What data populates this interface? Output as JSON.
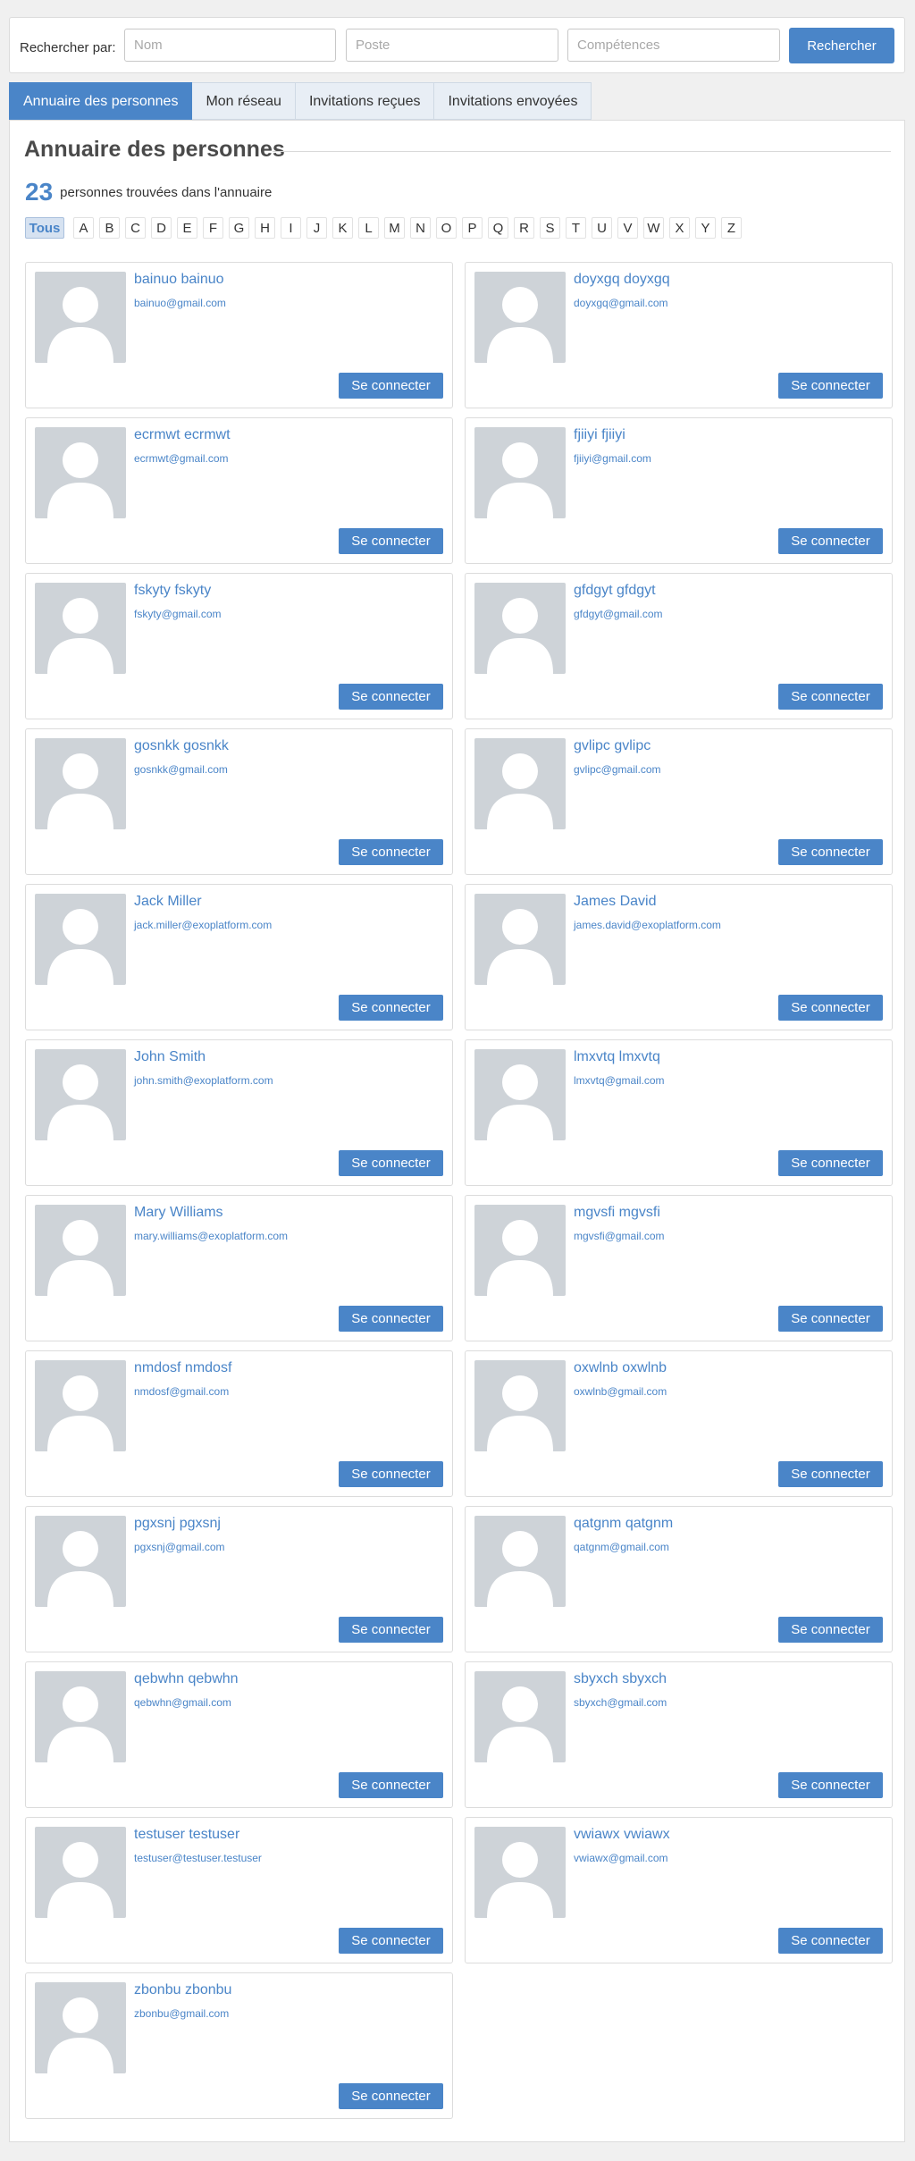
{
  "search": {
    "label": "Rechercher par:",
    "name_placeholder": "Nom",
    "position_placeholder": "Poste",
    "skills_placeholder": "Compétences",
    "button": "Rechercher"
  },
  "tabs": [
    {
      "label": "Annuaire des personnes",
      "active": true
    },
    {
      "label": "Mon réseau",
      "active": false
    },
    {
      "label": "Invitations reçues",
      "active": false
    },
    {
      "label": "Invitations envoyées",
      "active": false
    }
  ],
  "directory": {
    "title": "Annuaire des personnes",
    "count": "23",
    "count_text": "personnes trouvées dans l'annuaire",
    "all_label": "Tous",
    "letters": [
      "A",
      "B",
      "C",
      "D",
      "E",
      "F",
      "G",
      "H",
      "I",
      "J",
      "K",
      "L",
      "M",
      "N",
      "O",
      "P",
      "Q",
      "R",
      "S",
      "T",
      "U",
      "V",
      "W",
      "X",
      "Y",
      "Z"
    ],
    "connect_label": "Se connecter"
  },
  "people": [
    {
      "name": "bainuo bainuo",
      "email": "bainuo@gmail.com"
    },
    {
      "name": "doyxgq doyxgq",
      "email": "doyxgq@gmail.com"
    },
    {
      "name": "ecrmwt ecrmwt",
      "email": "ecrmwt@gmail.com"
    },
    {
      "name": "fjiiyi fjiiyi",
      "email": "fjiiyi@gmail.com"
    },
    {
      "name": "fskyty fskyty",
      "email": "fskyty@gmail.com"
    },
    {
      "name": "gfdgyt gfdgyt",
      "email": "gfdgyt@gmail.com"
    },
    {
      "name": "gosnkk gosnkk",
      "email": "gosnkk@gmail.com"
    },
    {
      "name": "gvlipc gvlipc",
      "email": "gvlipc@gmail.com"
    },
    {
      "name": "Jack Miller",
      "email": "jack.miller@exoplatform.com"
    },
    {
      "name": "James David",
      "email": "james.david@exoplatform.com"
    },
    {
      "name": "John Smith",
      "email": "john.smith@exoplatform.com"
    },
    {
      "name": "lmxvtq lmxvtq",
      "email": "lmxvtq@gmail.com"
    },
    {
      "name": "Mary Williams",
      "email": "mary.williams@exoplatform.com"
    },
    {
      "name": "mgvsfi mgvsfi",
      "email": "mgvsfi@gmail.com"
    },
    {
      "name": "nmdosf nmdosf",
      "email": "nmdosf@gmail.com"
    },
    {
      "name": "oxwlnb oxwlnb",
      "email": "oxwlnb@gmail.com"
    },
    {
      "name": "pgxsnj pgxsnj",
      "email": "pgxsnj@gmail.com"
    },
    {
      "name": "qatgnm qatgnm",
      "email": "qatgnm@gmail.com"
    },
    {
      "name": "qebwhn qebwhn",
      "email": "qebwhn@gmail.com"
    },
    {
      "name": "sbyxch sbyxch",
      "email": "sbyxch@gmail.com"
    },
    {
      "name": "testuser testuser",
      "email": "testuser@testuser.testuser"
    },
    {
      "name": "vwiawx vwiawx",
      "email": "vwiawx@gmail.com"
    },
    {
      "name": "zbonbu zbonbu",
      "email": "zbonbu@gmail.com"
    }
  ],
  "colors": {
    "accent": "#4a85c8",
    "avatar_bg": "#ced3d8",
    "avatar_silhouette": "#ffffff"
  },
  "icons": {
    "avatar": "default-user-silhouette-icon"
  }
}
